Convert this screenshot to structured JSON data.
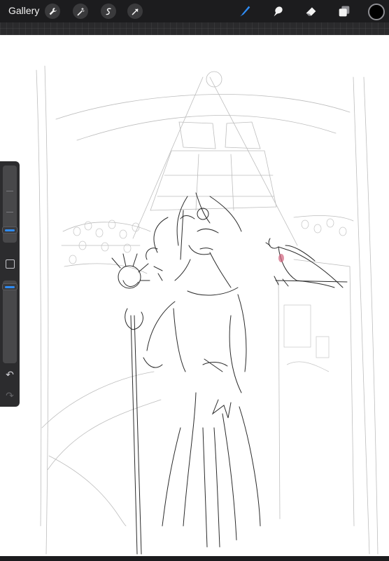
{
  "toolbar": {
    "gallery_label": "Gallery",
    "left_tools": [
      "wrench-icon",
      "magic-wand-icon",
      "selection-icon",
      "transform-arrow-icon"
    ],
    "right_tools": [
      "brush-icon",
      "smudge-icon",
      "eraser-icon",
      "layers-icon"
    ],
    "active_tool": "brush-icon",
    "accent_color": "#2f8cf4",
    "current_color": "#000000"
  },
  "sidebar": {
    "brush_size_level": 0.9,
    "opacity_level": 0.92,
    "undo_icon": "undo-icon",
    "redo_icon": "redo-icon"
  },
  "canvas": {
    "background": "#ffffff",
    "stroke_color": "#2b2b2b"
  }
}
